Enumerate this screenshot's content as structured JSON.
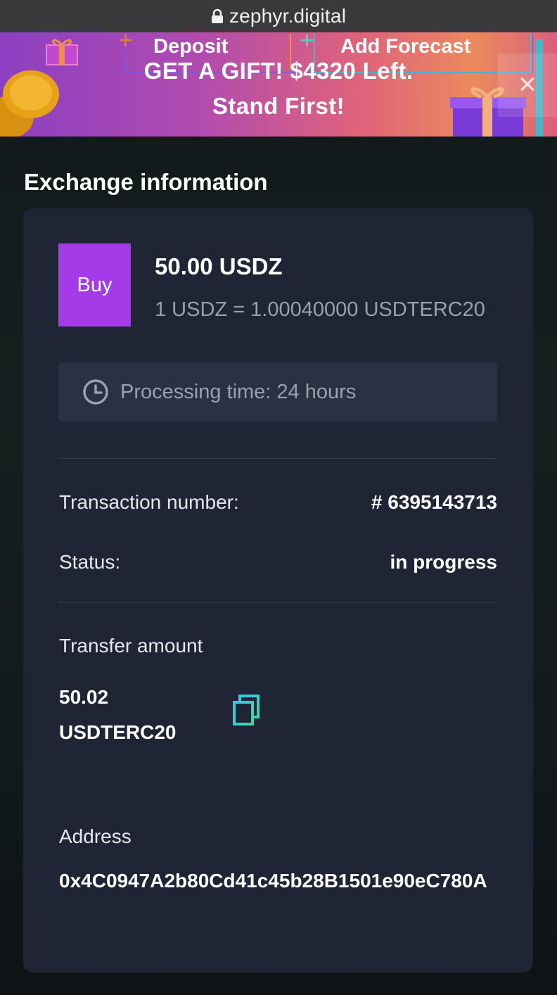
{
  "browser": {
    "url": "zephyr.digital",
    "lock_icon": "lock-icon"
  },
  "banner": {
    "nav": {
      "deposit_label": "Deposit",
      "forecast_label": "Add Forecast"
    },
    "headline_line1": "GET A GIFT! $4320 Left.",
    "headline_line2": "Stand First!",
    "close_icon": "close-icon",
    "colors": {
      "gradient_start": "#8c3fc2",
      "gradient_end": "#eb8a5e"
    }
  },
  "section": {
    "title": "Exchange information"
  },
  "exchange": {
    "badge_label": "Buy",
    "badge_color": "#a43ae8",
    "amount": "50.00 USDZ",
    "rate": "1 USDZ = 1.00040000 USDTERC20",
    "processing_time": "Processing time: 24 hours",
    "transaction_label": "Transaction number:",
    "transaction_value": "# 6395143713",
    "status_label": "Status:",
    "status_value": "in progress",
    "transfer_label": "Transfer amount",
    "transfer_value_line1": "50.02",
    "transfer_value_line2": "USDTERC20",
    "copy_icon": "copy-icon",
    "address_label": "Address",
    "address_value": "0x4C0947A2b80Cd41c45b28B1501e90eC780A"
  }
}
